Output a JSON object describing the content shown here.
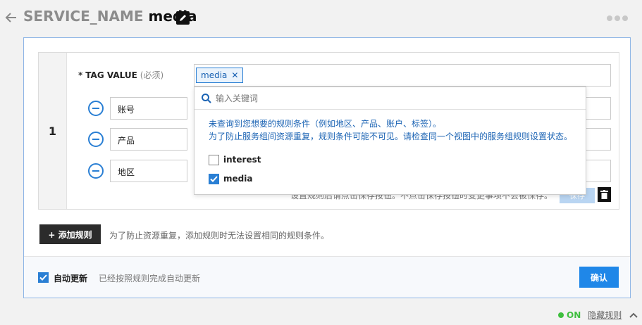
{
  "header": {
    "service_name": "SERVICE_NAME",
    "resource_name": "media"
  },
  "rule": {
    "index": "1",
    "tag_label": "TAG VALUE",
    "required_mark": "*",
    "required_hint": "(必须)",
    "selected_tag": "media",
    "conditions": [
      {
        "label": "账号"
      },
      {
        "label": "产品"
      },
      {
        "label": "地区"
      }
    ],
    "save_note": "设置规则后请点击保存按钮。不点击保存按钮时变更事项不会被保存。",
    "save_label": "保存"
  },
  "dropdown": {
    "search_placeholder": "输入关键词",
    "message_line1": "未查询到您想要的规则条件（例如地区、产品、账户、标签）。",
    "message_line2": "为了防止服务组间资源重复，规则条件可能不可见。请检查同一个视图中的服务组规则设置状态。",
    "options": [
      {
        "label": "interest",
        "checked": false
      },
      {
        "label": "media",
        "checked": true
      }
    ]
  },
  "add_rule": {
    "label": "+ 添加规则",
    "note": "为了防止资源重复，添加规则时无法设置相同的规则条件。"
  },
  "footer": {
    "auto_update_label": "自动更新",
    "auto_update_checked": true,
    "auto_update_note": "已经按照规则完成自动更新",
    "confirm_label": "确认"
  },
  "status": {
    "state": "ON",
    "hide_link": "隐藏规则"
  },
  "colors": {
    "accent": "#2a7fd4",
    "status_on": "#3fbf3f"
  }
}
